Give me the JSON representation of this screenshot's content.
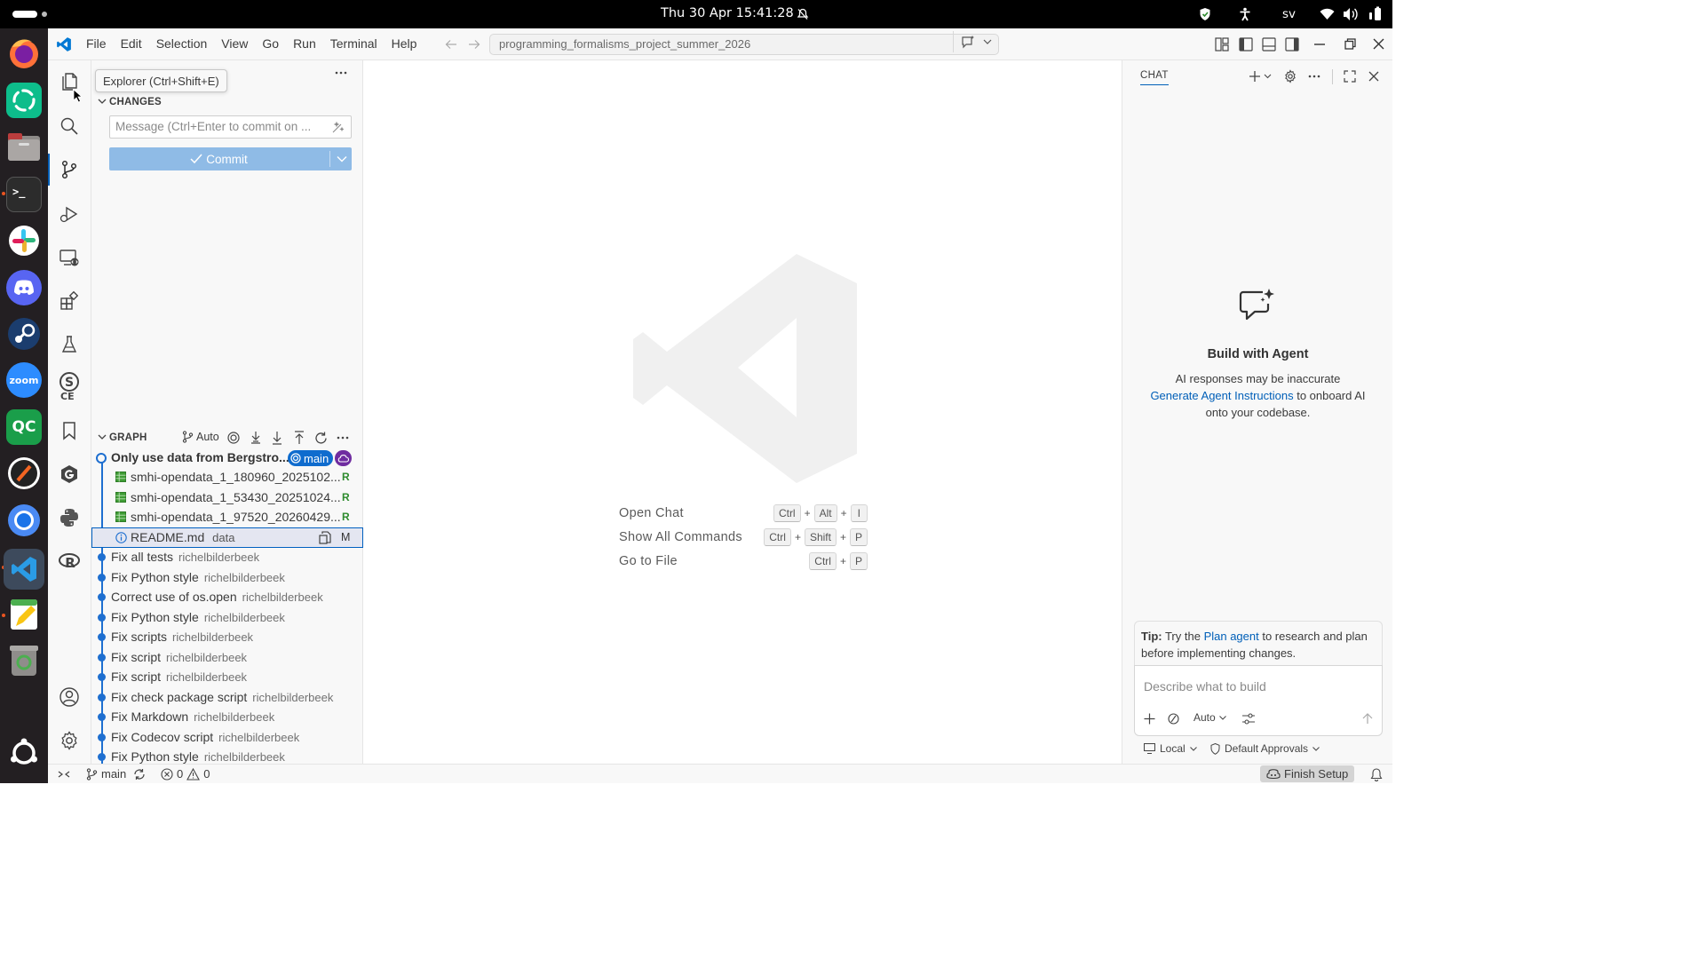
{
  "system_bar": {
    "clock": "Thu 30 Apr  15:41:28",
    "keyboard_layout": "sv"
  },
  "dock": {
    "apps": [
      "firefox",
      "element",
      "files",
      "terminal",
      "slack",
      "discord",
      "steam",
      "zoom",
      "qc",
      "mixer",
      "chromium",
      "vscode",
      "text-editor",
      "trash"
    ],
    "zoom_label": "zoom",
    "qc_label": "QC",
    "ubuntu": "show-apps"
  },
  "titlebar": {
    "menus": [
      "File",
      "Edit",
      "Selection",
      "View",
      "Go",
      "Run",
      "Terminal",
      "Help"
    ],
    "search_text": "programming_formalisms_project_summer_2026"
  },
  "activity": {
    "tooltip": "Explorer (Ctrl+Shift+E)",
    "ce_label": "CE"
  },
  "scm": {
    "changes_header": "CHANGES",
    "commit_placeholder": "Message (Ctrl+Enter to commit on ...",
    "commit_label": "Commit",
    "graph_header": "GRAPH",
    "graph_auto": "Auto",
    "head_commit": {
      "message": "Only use data from Bergstro...",
      "branch": "main"
    },
    "files": [
      {
        "name": "smhi-opendata_1_180960_2025102...",
        "status": "R",
        "kind": "csv"
      },
      {
        "name": "smhi-opendata_1_53430_20251024...",
        "status": "R",
        "kind": "csv"
      },
      {
        "name": "smhi-opendata_1_97520_20260429...",
        "status": "R",
        "kind": "csv"
      },
      {
        "name": "README.md",
        "dir": "data",
        "status": "M",
        "kind": "info"
      }
    ],
    "commits": [
      {
        "message": "Fix all tests",
        "author": "richelbilderbeek"
      },
      {
        "message": "Fix Python style",
        "author": "richelbilderbeek"
      },
      {
        "message": "Correct use of os.open",
        "author": "richelbilderbeek"
      },
      {
        "message": "Fix Python style",
        "author": "richelbilderbeek"
      },
      {
        "message": "Fix scripts",
        "author": "richelbilderbeek"
      },
      {
        "message": "Fix script",
        "author": "richelbilderbeek"
      },
      {
        "message": "Fix script",
        "author": "richelbilderbeek"
      },
      {
        "message": "Fix check package script",
        "author": "richelbilderbeek"
      },
      {
        "message": "Fix Markdown",
        "author": "richelbilderbeek"
      },
      {
        "message": "Fix Codecov script",
        "author": "richelbilderbeek"
      },
      {
        "message": "Fix Python style",
        "author": "richelbilderbeek"
      }
    ]
  },
  "editor": {
    "hints": [
      {
        "label": "Open Chat",
        "keys": [
          "Ctrl",
          "Alt",
          "I"
        ]
      },
      {
        "label": "Show All Commands",
        "keys": [
          "Ctrl",
          "Shift",
          "P"
        ]
      },
      {
        "label": "Go to File",
        "keys": [
          "Ctrl",
          "P"
        ]
      }
    ]
  },
  "chat": {
    "tab": "CHAT",
    "title": "Build with Agent",
    "disclaimer": "AI responses may be inaccurate",
    "link": "Generate Agent Instructions",
    "after_link": " to onboard AI",
    "line3": "onto your codebase.",
    "tip_label": "Tip:",
    "tip_pre": " Try the ",
    "tip_link": "Plan agent",
    "tip_post": " to research and plan before implementing changes.",
    "input_placeholder": "Describe what to build",
    "mode": "Auto",
    "location": "Local",
    "approvals": "Default Approvals"
  },
  "statusbar": {
    "branch": "main",
    "errors": "0",
    "warnings": "0",
    "finish_setup": "Finish Setup"
  },
  "colors": {
    "accent": "#005fb8",
    "commit_button": "#8fbbe6",
    "graph_line": "#1e6fd0",
    "branch_badge": "#0f6cce",
    "cloud_badge": "#6f2ca0",
    "added": "#2e8b2e"
  }
}
